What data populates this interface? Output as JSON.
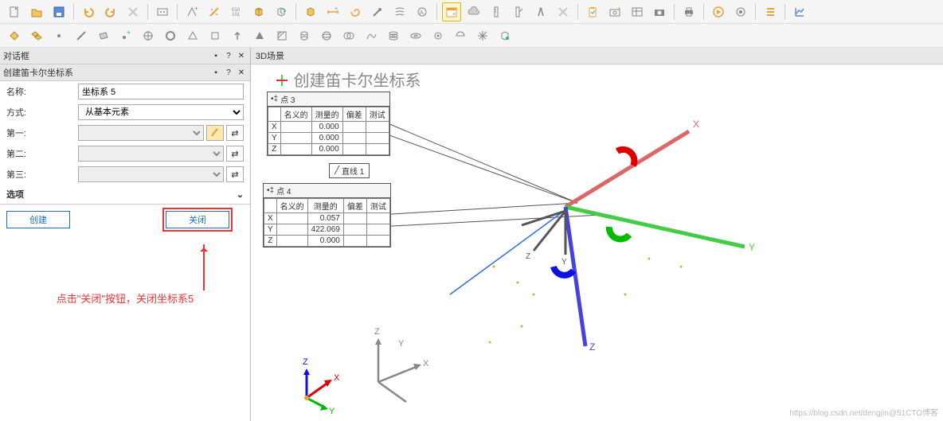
{
  "toolbar1": {
    "icons": [
      "new-file",
      "open-file",
      "save",
      "undo",
      "redo",
      "delete",
      "settings",
      "add-feature",
      "magic",
      "binary",
      "cube",
      "cube-refresh",
      "box",
      "ruler",
      "spiral",
      "probe",
      "flow",
      "dimension",
      "calendar",
      "cloud",
      "measure-tool",
      "angle",
      "align",
      "compass",
      "delete2",
      "clipboard",
      "camera-add",
      "table",
      "camera",
      "print",
      "play",
      "gear-play",
      "list",
      "chart"
    ]
  },
  "toolbar2": {
    "icons": [
      "diamond",
      "diamonds",
      "circle",
      "line",
      "layers",
      "plus-point",
      "crosshair",
      "ring",
      "triangle",
      "square",
      "arrow-up",
      "triangle-solid",
      "hatch",
      "cylinder",
      "sphere",
      "merge",
      "path",
      "stack",
      "torus",
      "gear",
      "half-sphere",
      "star",
      "hex"
    ]
  },
  "panel": {
    "title": "对话框",
    "subtitle": "创建笛卡尔坐标系",
    "fields": {
      "name_label": "名称:",
      "name_value": "坐标系 5",
      "method_label": "方式:",
      "method_value": "从基本元素",
      "first_label": "第一:",
      "second_label": "第二:",
      "third_label": "第三:",
      "options_label": "选项"
    },
    "buttons": {
      "create": "创建",
      "close": "关闭"
    },
    "annotation": "点击\"关闭\"按钮，关闭坐标系5"
  },
  "scene": {
    "header": "3D场景",
    "title": "创建笛卡尔坐标系",
    "axis_labels": {
      "x": "X",
      "y": "Y",
      "z": "Z"
    },
    "mini_axis": {
      "x": "X",
      "y": "Y",
      "z": "Z"
    },
    "tiny_axis": {
      "x": "X",
      "y": "Y",
      "z": "Z"
    },
    "line_tag": "直线 1",
    "point3": {
      "title": "点 3",
      "headers": [
        "名义的",
        "测量的",
        "偏差",
        "测试"
      ],
      "rows": [
        {
          "axis": "X",
          "nominal": "",
          "measured": "0.000",
          "dev": "",
          "test": ""
        },
        {
          "axis": "Y",
          "nominal": "",
          "measured": "0.000",
          "dev": "",
          "test": ""
        },
        {
          "axis": "Z",
          "nominal": "",
          "measured": "0.000",
          "dev": "",
          "test": ""
        }
      ]
    },
    "point4": {
      "title": "点 4",
      "headers": [
        "名义的",
        "测量的",
        "偏差",
        "测试"
      ],
      "rows": [
        {
          "axis": "X",
          "nominal": "",
          "measured": "0.057",
          "dev": "",
          "test": ""
        },
        {
          "axis": "Y",
          "nominal": "",
          "measured": "422.069",
          "dev": "",
          "test": ""
        },
        {
          "axis": "Z",
          "nominal": "",
          "measured": "0.000",
          "dev": "",
          "test": ""
        }
      ]
    }
  },
  "watermark": "https://blog.csdn.net/dengjin@51CTO博客"
}
